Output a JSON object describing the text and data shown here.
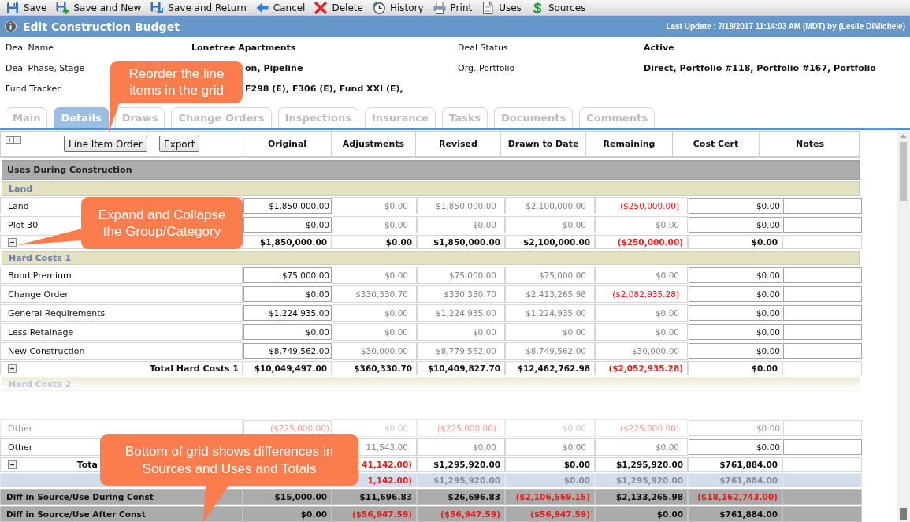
{
  "toolbar": [
    {
      "kind": "save",
      "label": "Save"
    },
    {
      "kind": "new",
      "label": "Save and New"
    },
    {
      "kind": "return",
      "label": "Save and Return"
    },
    {
      "kind": "cancel",
      "label": "Cancel"
    },
    {
      "kind": "delete",
      "label": "Delete"
    },
    {
      "kind": "history",
      "label": "History"
    },
    {
      "kind": "print",
      "label": "Print"
    },
    {
      "kind": "uses",
      "label": "Uses"
    },
    {
      "kind": "sources",
      "label": "Sources"
    }
  ],
  "title": "Edit Construction Budget",
  "last_update": "Last Update : 7/18/2017 11:14:03 AM (MDT) by (Leslie DiMichele)",
  "fields": [
    {
      "label": "Deal Name",
      "value": "Lonetree Apartments"
    },
    {
      "label": "Deal Status",
      "value": "Active"
    },
    {
      "label": "Deal Phase, Stage",
      "value": "on, Pipeline"
    },
    {
      "label": "Org. Portfolio",
      "value": "Direct, Portfolio #118, Portfolio #167, Portfolio"
    },
    {
      "label": "Fund Tracker",
      "value": "F298 (E), F306 (E), Fund XXI (E),"
    }
  ],
  "tabs": [
    {
      "label": "Main",
      "selected": false
    },
    {
      "label": "Details",
      "selected": true
    },
    {
      "label": "Draws",
      "selected": false
    },
    {
      "label": "Change Orders",
      "selected": false
    },
    {
      "label": "Inspections",
      "selected": false
    },
    {
      "label": "Insurance",
      "selected": false
    },
    {
      "label": "Tasks",
      "selected": false
    },
    {
      "label": "Documents",
      "selected": false
    },
    {
      "label": "Comments",
      "selected": false
    }
  ],
  "grid": {
    "buttons": [
      "Line Item Order",
      "Export"
    ],
    "columns": [
      "Original",
      "Adjustments",
      "Revised",
      "Drawn to Date",
      "Remaining",
      "Cost Cert",
      "Notes"
    ],
    "rows": [
      {
        "kind": "section",
        "label": "Uses During Construction",
        "faded": false
      },
      {
        "kind": "group",
        "label": "Land",
        "faded": false
      },
      {
        "kind": "item",
        "label": "Land",
        "faded": false,
        "cells": [
          {
            "text": "$1,850,000.00",
            "negative": false
          },
          {
            "text": "$0.00",
            "negative": false
          },
          {
            "text": "$1,850,000.00",
            "negative": false
          },
          {
            "text": "$2,100,000.00",
            "negative": false
          },
          {
            "text": "($250,000.00)",
            "negative": true
          },
          {
            "text": "$0.00",
            "negative": false
          }
        ]
      },
      {
        "kind": "item",
        "label": "Plot 30",
        "faded": false,
        "cells": [
          {
            "text": "$0.00",
            "negative": false
          },
          {
            "text": "$0.00",
            "negative": false
          },
          {
            "text": "$0.00",
            "negative": false
          },
          {
            "text": "$0.00",
            "negative": false
          },
          {
            "text": "$0.00",
            "negative": false
          },
          {
            "text": "$0.00",
            "negative": false
          }
        ]
      },
      {
        "kind": "subtotal",
        "faded": false,
        "cells": [
          {
            "text": "$1,850,000.00",
            "negative": false
          },
          {
            "text": "$0.00",
            "negative": false
          },
          {
            "text": "$1,850,000.00",
            "negative": false
          },
          {
            "text": "$2,100,000.00",
            "negative": false
          },
          {
            "text": "($250,000.00)",
            "negative": true
          },
          {
            "text": "$0.00",
            "negative": false
          }
        ]
      },
      {
        "kind": "group",
        "label": "Hard Costs 1",
        "faded": false
      },
      {
        "kind": "item",
        "label": "Bond Premium",
        "faded": false,
        "cells": [
          {
            "text": "$75,000.00",
            "negative": false
          },
          {
            "text": "$0.00",
            "negative": false
          },
          {
            "text": "$75,000.00",
            "negative": false
          },
          {
            "text": "$75,000.00",
            "negative": false
          },
          {
            "text": "$0.00",
            "negative": false
          },
          {
            "text": "$0.00",
            "negative": false
          }
        ]
      },
      {
        "kind": "item",
        "label": "Change Order",
        "faded": false,
        "cells": [
          {
            "text": "$0.00",
            "negative": false
          },
          {
            "text": "$330,330.70",
            "negative": false
          },
          {
            "text": "$330,330.70",
            "negative": false
          },
          {
            "text": "$2,413,265.98",
            "negative": false
          },
          {
            "text": "($2,082,935.28)",
            "negative": true
          },
          {
            "text": "$0.00",
            "negative": false
          }
        ]
      },
      {
        "kind": "item",
        "label": "General Requirements",
        "faded": false,
        "cells": [
          {
            "text": "$1,224,935.00",
            "negative": false
          },
          {
            "text": "$0.00",
            "negative": false
          },
          {
            "text": "$1,224,935.00",
            "negative": false
          },
          {
            "text": "$1,224,935.00",
            "negative": false
          },
          {
            "text": "$0.00",
            "negative": false
          },
          {
            "text": "$0.00",
            "negative": false
          }
        ]
      },
      {
        "kind": "item",
        "label": "Less Retainage",
        "faded": false,
        "cells": [
          {
            "text": "$0.00",
            "negative": false
          },
          {
            "text": "$0.00",
            "negative": false
          },
          {
            "text": "$0.00",
            "negative": false
          },
          {
            "text": "$0.00",
            "negative": false
          },
          {
            "text": "$0.00",
            "negative": false
          },
          {
            "text": "$0.00",
            "negative": false
          }
        ]
      },
      {
        "kind": "item",
        "label": "New Construction",
        "faded": false,
        "cells": [
          {
            "text": "$8,749,562.00",
            "negative": false
          },
          {
            "text": "$30,000.00",
            "negative": false
          },
          {
            "text": "$8,779,562.00",
            "negative": false
          },
          {
            "text": "$8,749,562.00",
            "negative": false
          },
          {
            "text": "$30,000.00",
            "negative": false
          },
          {
            "text": "$0.00",
            "negative": false
          }
        ]
      },
      {
        "kind": "subtotal",
        "label": "Total Hard Costs 1",
        "faded": false,
        "cells": [
          {
            "text": "$10,049,497.00",
            "negative": false
          },
          {
            "text": "$360,330.70",
            "negative": false
          },
          {
            "text": "$10,409,827.70",
            "negative": false
          },
          {
            "text": "$12,462,762.98",
            "negative": false
          },
          {
            "text": "($2,052,935.28)",
            "negative": true
          },
          {
            "text": "$0.00",
            "negative": false
          }
        ]
      },
      {
        "kind": "group",
        "label": "Hard Costs 2",
        "faded": true
      },
      {
        "kind": "item",
        "label": "Other",
        "faded": true,
        "cells": [
          {
            "text": "($225,000.00)",
            "negative": true
          },
          {
            "text": "$0.00",
            "negative": false
          },
          {
            "text": "($225,000.00)",
            "negative": true
          },
          {
            "text": "$0.00",
            "negative": false
          },
          {
            "text": "($225,000.00)",
            "negative": true
          },
          {
            "text": "$0.00",
            "negative": false
          }
        ]
      },
      {
        "kind": "item",
        "label": "Other",
        "faded": false,
        "cells": [
          null,
          {
            "text": "11,543.00",
            "negative": false
          },
          {
            "text": "$0.00",
            "negative": false
          },
          {
            "text": "$0.00",
            "negative": false
          },
          {
            "text": "$0.00",
            "negative": false
          },
          {
            "text": "$0.00",
            "negative": false
          }
        ]
      },
      {
        "kind": "total",
        "label": "Tota",
        "faded": false,
        "cells": [
          null,
          {
            "text": "41,142.00)",
            "negative": true
          },
          {
            "text": "$1,295,920.00",
            "negative": false
          },
          {
            "text": "$0.00",
            "negative": false
          },
          {
            "text": "$1,295,920.00",
            "negative": false
          },
          {
            "text": "$761,884.00",
            "negative": false
          }
        ]
      },
      {
        "kind": "summary",
        "faded": false,
        "cells": [
          null,
          {
            "text": "1,142.00)",
            "negative": true
          },
          {
            "text": "$1,295,920.00",
            "negative": false
          },
          {
            "text": "$0.00",
            "negative": false
          },
          {
            "text": "$1,295,920.00",
            "negative": false
          },
          {
            "text": "$761,884.00",
            "negative": false
          }
        ]
      },
      {
        "kind": "diff",
        "label": "Diff in Source/Use During Const",
        "faded": false,
        "cells": [
          {
            "text": "$15,000.00",
            "negative": false
          },
          {
            "text": "$11,696.83",
            "negative": false
          },
          {
            "text": "$26,696.83",
            "negative": false
          },
          {
            "text": "($2,106,569.15)",
            "negative": true
          },
          {
            "text": "$2,133,265.98",
            "negative": false
          },
          {
            "text": "($18,162,743.00)",
            "negative": true
          }
        ]
      },
      {
        "kind": "diff",
        "label": "Diff in Source/Use After Const",
        "faded": false,
        "cells": [
          {
            "text": "$0.00",
            "negative": false
          },
          {
            "text": "($56,947.59)",
            "negative": true
          },
          {
            "text": "($56,947.59)",
            "negative": true
          },
          {
            "text": "($56,947.59)",
            "negative": true
          },
          {
            "text": "$0.00",
            "negative": false
          },
          {
            "text": "$761,884.00",
            "negative": false
          }
        ]
      }
    ]
  },
  "callouts": [
    {
      "text": "Reorder the line items in the grid"
    },
    {
      "text": "Expand and Collapse the Group/Category"
    },
    {
      "text": "Bottom of grid shows differences in Sources and Uses and Totals"
    }
  ]
}
